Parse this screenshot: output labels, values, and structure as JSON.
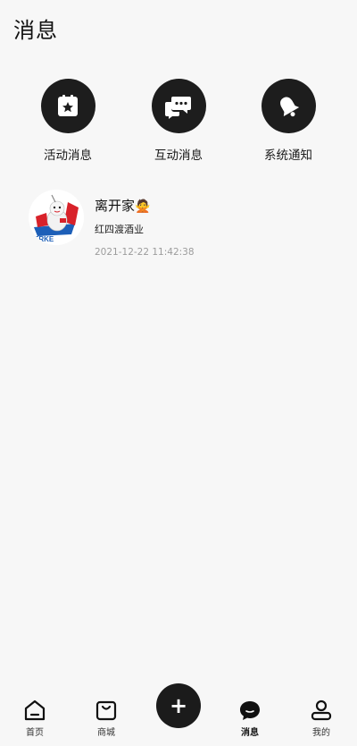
{
  "header": {
    "title": "消息"
  },
  "quick_actions": [
    {
      "label": "活动消息",
      "icon": "calendar-star-icon"
    },
    {
      "label": "互动消息",
      "icon": "chat-bubbles-icon"
    },
    {
      "label": "系统通知",
      "icon": "bell-icon"
    }
  ],
  "messages": [
    {
      "name": "离开家",
      "emoji": "🙅",
      "subtitle": "红四渡酒业",
      "time": "2021-12-22 11:42:38",
      "avatar_icon": "erke-mascot-avatar-icon",
      "avatar_logo_text": "ERKE"
    }
  ],
  "tabbar": {
    "items": [
      {
        "label": "首页",
        "icon": "home-icon"
      },
      {
        "label": "商城",
        "icon": "shopping-bag-icon"
      },
      {
        "label": "消息",
        "icon": "message-bubble-icon",
        "active": true
      },
      {
        "label": "我的",
        "icon": "user-icon"
      }
    ],
    "center_icon": "plus-icon",
    "center_symbol": "+"
  },
  "colors": {
    "background": "#f7f7f7",
    "icon_dark": "#1d1d1d",
    "time_gray": "#9c9c9c"
  }
}
